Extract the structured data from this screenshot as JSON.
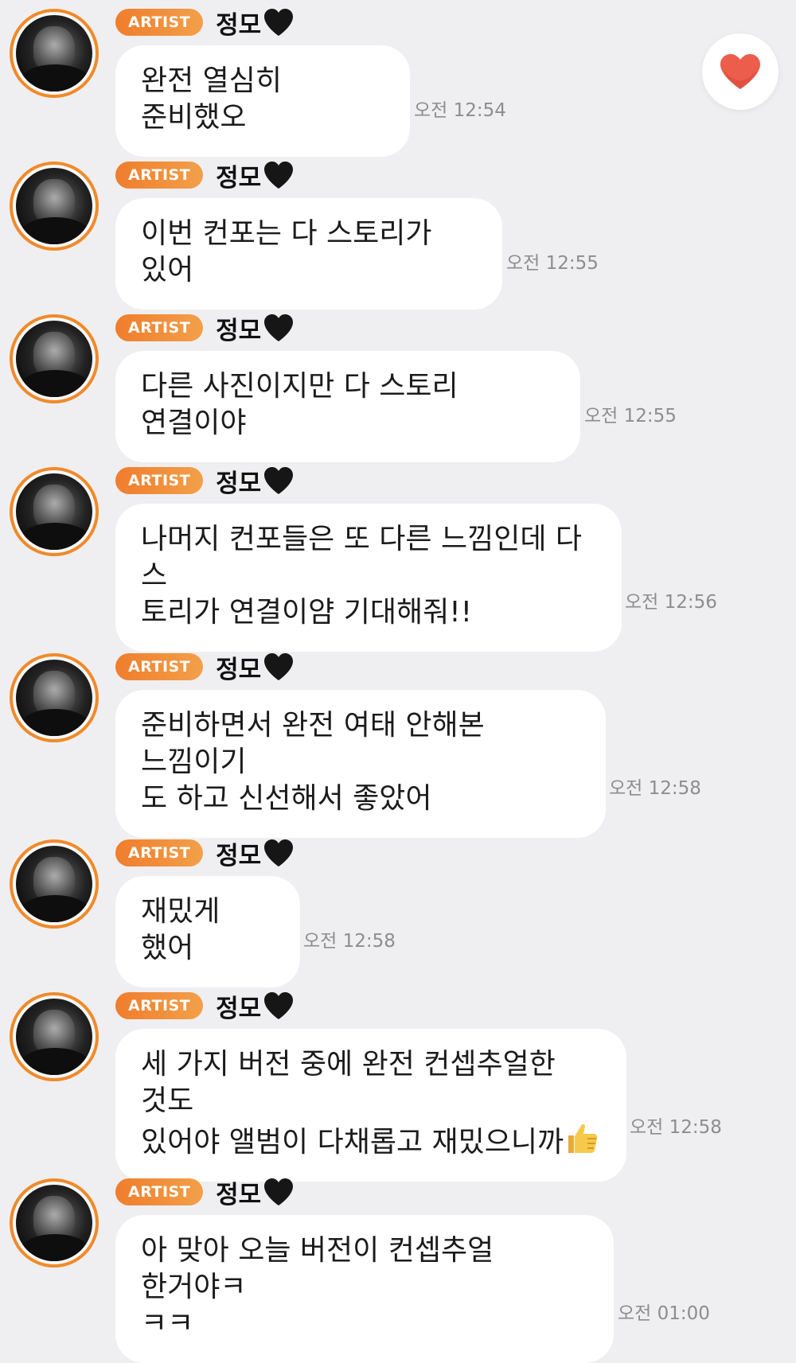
{
  "colors": {
    "background": "#efeff1",
    "bubble": "#ffffff",
    "accent": "#f07d2c",
    "like": "#ec5d4b"
  },
  "like_button": {
    "icon": "heart-icon"
  },
  "messages": [
    {
      "badge": "ARTIST",
      "sender": "정모",
      "text": "완전 열심히 준비했오",
      "time": "오전 12:54"
    },
    {
      "badge": "ARTIST",
      "sender": "정모",
      "text": "이번 컨포는 다 스토리가 있어",
      "time": "오전 12:55"
    },
    {
      "badge": "ARTIST",
      "sender": "정모",
      "text": "다른 사진이지만 다 스토리 연결이야",
      "time": "오전 12:55"
    },
    {
      "badge": "ARTIST",
      "sender": "정모",
      "text": "나머지 컨포들은 또 다른 느낌인데 다 스\n토리가 연결이얌 기대해줘!!",
      "time": "오전 12:56"
    },
    {
      "badge": "ARTIST",
      "sender": "정모",
      "text": "준비하면서 완전 여태 안해본 느낌이기\n도 하고 신선해서 좋았어",
      "time": "오전 12:58"
    },
    {
      "badge": "ARTIST",
      "sender": "정모",
      "text": "재밌게 했어",
      "time": "오전 12:58"
    },
    {
      "badge": "ARTIST",
      "sender": "정모",
      "text": "세 가지 버전 중에 완전 컨셉추얼한 것도\n있어야 앨범이 다채롭고 재밌으니까",
      "emoji": "thumbs-up-icon",
      "time": "오전 12:58"
    },
    {
      "badge": "ARTIST",
      "sender": "정모",
      "text": "아 맞아 오늘 버전이 컨셉추얼 한거야ㅋ\nㅋㅋ",
      "time": "오전 01:00"
    }
  ]
}
